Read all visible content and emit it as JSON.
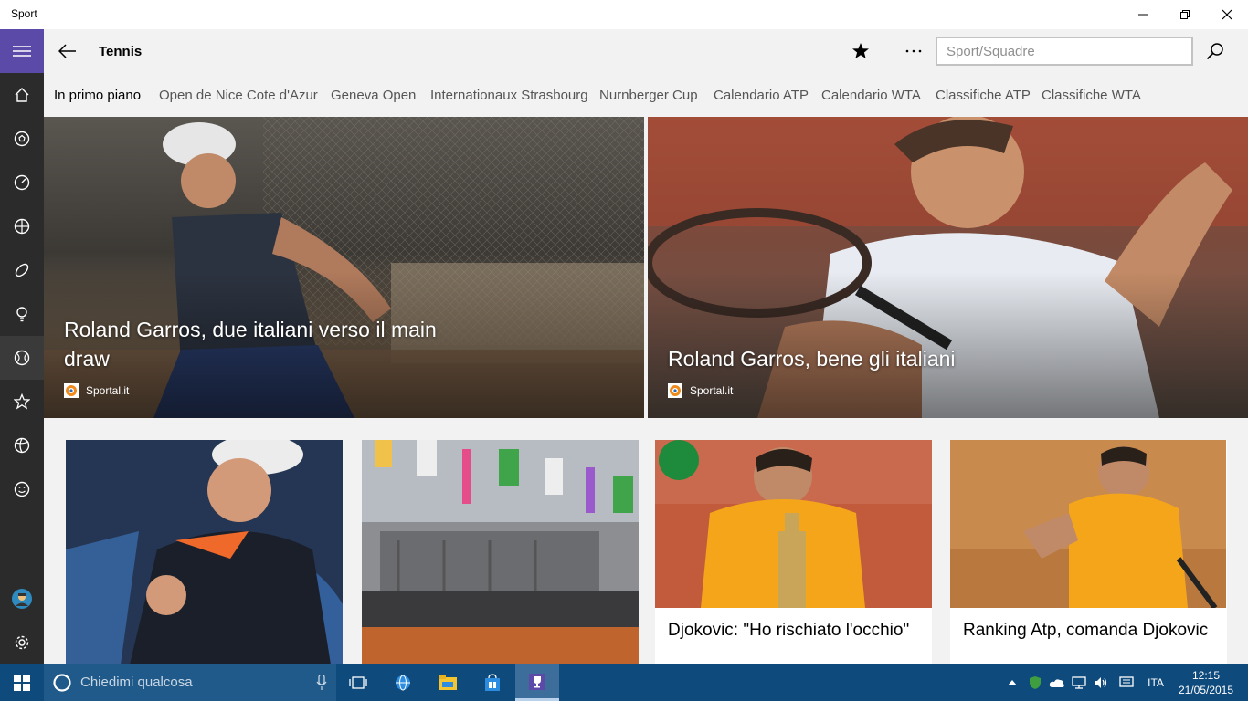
{
  "window": {
    "app_title": "Sport"
  },
  "header": {
    "page_title": "Tennis",
    "search_placeholder": "Sport/Squadre"
  },
  "sidebar": {
    "items": [
      {
        "icon": "hamburger-menu-icon"
      },
      {
        "icon": "home-icon"
      },
      {
        "icon": "soccer-ball-icon"
      },
      {
        "icon": "speedometer-icon"
      },
      {
        "icon": "basketball-icon"
      },
      {
        "icon": "football-icon"
      },
      {
        "icon": "light-bulb-icon"
      },
      {
        "icon": "tennis-ball-icon"
      },
      {
        "icon": "star-icon"
      },
      {
        "icon": "volleyball-icon"
      },
      {
        "icon": "smiley-icon"
      },
      {
        "icon": "avatar"
      },
      {
        "icon": "settings-icon"
      }
    ]
  },
  "tabs": [
    {
      "label": "In primo piano"
    },
    {
      "label": "Open de Nice Cote d'Azur"
    },
    {
      "label": "Geneva Open"
    },
    {
      "label": "Internationaux Strasbourg"
    },
    {
      "label": "Nurnberger Cup"
    },
    {
      "label": "Calendario ATP"
    },
    {
      "label": "Calendario WTA"
    },
    {
      "label": "Classifiche ATP"
    },
    {
      "label": "Classifiche WTA"
    }
  ],
  "heroes": [
    {
      "title": "Roland Garros, due italiani verso il main draw",
      "source": "Sportal.it"
    },
    {
      "title": "Roland Garros, bene gli italiani",
      "source": "Sportal.it"
    }
  ],
  "cards": [
    {
      "title": ""
    },
    {
      "title": ""
    },
    {
      "title": "Djokovic: \"Ho rischiato l'occhio\""
    },
    {
      "title": "Ranking Atp, comanda Djokovic"
    }
  ],
  "taskbar": {
    "cortana_placeholder": "Chiedimi qualcosa",
    "language": "ITA",
    "time": "12:15",
    "date": "21/05/2015"
  },
  "colors": {
    "accent": "#5b4aa8",
    "sidebar": "#2b2b2b",
    "taskbar": "#0f4a7c"
  }
}
